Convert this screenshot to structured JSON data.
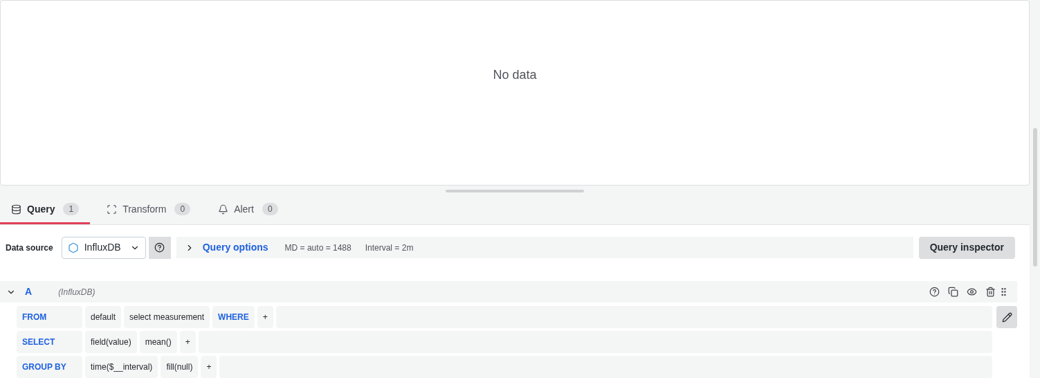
{
  "panel": {
    "message": "No data"
  },
  "tabs": [
    {
      "kind": "database",
      "label": "Query",
      "count": "1",
      "selected": true
    },
    {
      "kind": "transform",
      "label": "Transform",
      "count": "0",
      "selected": false
    },
    {
      "kind": "bell",
      "label": "Alert",
      "count": "0",
      "selected": false
    }
  ],
  "data_source": {
    "label": "Data source",
    "value": "InfluxDB",
    "options_label": "Query options",
    "max_data_points": "MD = auto = 1488",
    "interval": "Interval = 2m",
    "inspector_button": "Query inspector"
  },
  "query": {
    "ref": "A",
    "source": "(InfluxDB)",
    "expanded": true,
    "rows": [
      {
        "label": "FROM",
        "edit_button": true,
        "segments": [
          {
            "kind": "value",
            "text": "default"
          },
          {
            "kind": "value",
            "text": "select measurement"
          },
          {
            "kind": "keyword",
            "text": "WHERE"
          },
          {
            "kind": "add",
            "text": "+"
          }
        ]
      },
      {
        "label": "SELECT",
        "edit_button": false,
        "segments": [
          {
            "kind": "value",
            "text": "field(value)"
          },
          {
            "kind": "value",
            "text": "mean()"
          },
          {
            "kind": "add",
            "text": "+"
          }
        ]
      },
      {
        "label": "GROUP BY",
        "edit_button": false,
        "segments": [
          {
            "kind": "value",
            "text": "time($__interval)"
          },
          {
            "kind": "value",
            "text": "fill(null)"
          },
          {
            "kind": "add",
            "text": "+"
          }
        ]
      }
    ]
  }
}
